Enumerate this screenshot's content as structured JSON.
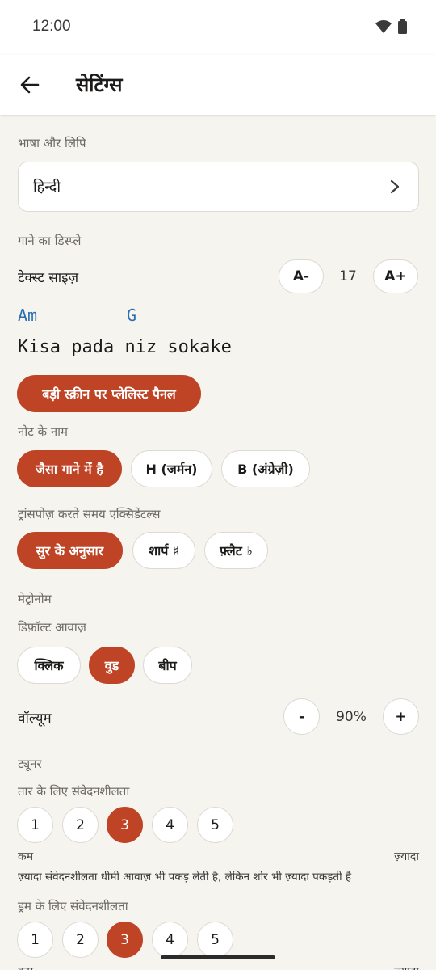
{
  "status_bar": {
    "time": "12:00",
    "wifi_icon": "wifi-icon",
    "battery_icon": "battery-icon"
  },
  "app_bar": {
    "back_icon": "arrow-back-icon",
    "title": "सेटिंग्स"
  },
  "language": {
    "section_label": "भाषा और लिपि",
    "value": "हिन्दी",
    "chevron_icon": "chevron-right-icon"
  },
  "song_display": {
    "section_label": "गाने का डिस्प्ले",
    "text_size": {
      "label": "टेक्स्ट साइज़",
      "decrease": "A-",
      "value": "17",
      "increase": "A+"
    },
    "preview": {
      "chords": [
        "Am",
        "G"
      ],
      "lyric": "Kisa pada niz sokake"
    },
    "playlist_panel_button": "बड़ी स्क्रीन पर प्लेलिस्ट पैनल"
  },
  "note_names": {
    "label": "नोट के नाम",
    "options": [
      "जैसा गाने में है",
      "H (जर्मन)",
      "B (अंग्रेज़ी)"
    ],
    "selected": 0
  },
  "accidentals": {
    "label": "ट्रांसपोज़ करते समय एक्सिडेंटल्स",
    "options": [
      "सुर के अनुसार",
      "शार्प ♯",
      "फ़्लैट ♭"
    ],
    "selected": 0
  },
  "metronome": {
    "section_label": "मेट्रोनोम",
    "sound_label": "डिफ़ॉल्ट आवाज़",
    "sounds": [
      "क्लिक",
      "वुड",
      "बीप"
    ],
    "selected": 1,
    "volume": {
      "label": "वॉल्यूम",
      "decrease": "-",
      "value": "90%",
      "increase": "+"
    }
  },
  "tuner": {
    "section_label": "ट्यूनर",
    "string_sensitivity": {
      "label": "तार के लिए संवेदनशीलता",
      "levels": [
        "1",
        "2",
        "3",
        "4",
        "5"
      ],
      "selected": 2,
      "low_label": "कम",
      "high_label": "ज़्यादा",
      "hint": "ज़्यादा संवेदनशीलता धीमी आवाज़ भी पकड़ लेती है, लेकिन शोर भी ज़्यादा पकड़ती है"
    },
    "drum_sensitivity": {
      "label": "ड्रम के लिए संवेदनशीलता",
      "levels": [
        "1",
        "2",
        "3",
        "4",
        "5"
      ],
      "selected": 2,
      "low_label": "कम",
      "high_label": "ज़्यादा"
    }
  },
  "colors": {
    "accent": "#bf4426",
    "chord": "#2a6fb0",
    "background": "#f6f4ef"
  }
}
